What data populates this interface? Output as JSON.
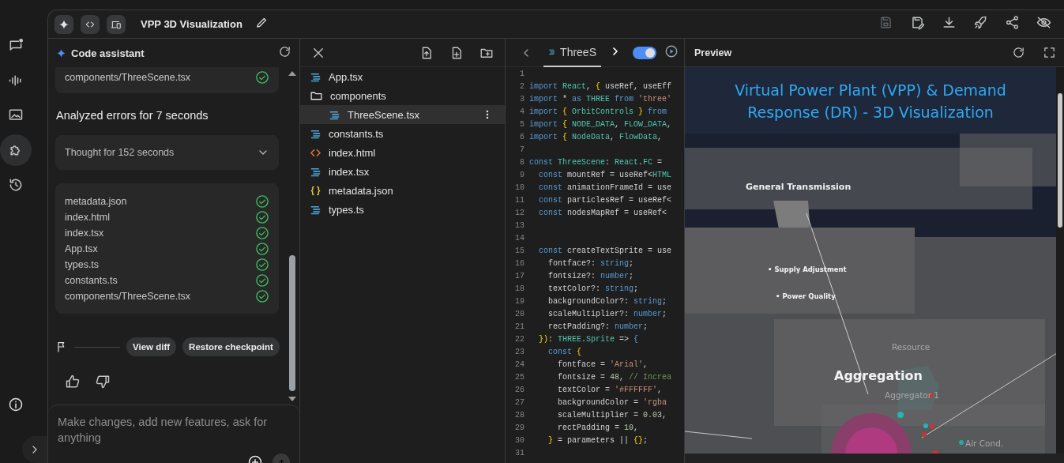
{
  "rail": {
    "items": [
      {
        "kind": "chat",
        "selected": false
      },
      {
        "kind": "audio",
        "selected": false
      },
      {
        "kind": "image",
        "selected": false
      },
      {
        "kind": "extension",
        "selected": true
      },
      {
        "kind": "history",
        "selected": false
      }
    ]
  },
  "toolbar": {
    "title": "VPP 3D Visualization",
    "actions": [
      {
        "kind": "save",
        "disabled": true
      },
      {
        "kind": "save-edit",
        "disabled": false
      },
      {
        "kind": "download",
        "disabled": false
      },
      {
        "kind": "rocket",
        "disabled": false
      },
      {
        "kind": "share",
        "disabled": false
      },
      {
        "kind": "eye-off",
        "disabled": false
      }
    ]
  },
  "assistant": {
    "title": "Code assistant",
    "earlier_files": [
      {
        "name": "components/ThreeScene.tsx",
        "done": true
      }
    ],
    "status": "Analyzed errors for 7 seconds",
    "thought": {
      "label": "Thought for 152 seconds",
      "expanded": false
    },
    "files": [
      {
        "name": "metadata.json",
        "done": true
      },
      {
        "name": "index.html",
        "done": true
      },
      {
        "name": "index.tsx",
        "done": true
      },
      {
        "name": "App.tsx",
        "done": true
      },
      {
        "name": "types.ts",
        "done": true
      },
      {
        "name": "constants.ts",
        "done": true
      },
      {
        "name": "components/ThreeScene.tsx",
        "done": true
      }
    ],
    "actions": [
      "View diff",
      "Restore checkpoint"
    ],
    "input": {
      "placeholder": "Make changes, add new features, ask for anything"
    }
  },
  "files": {
    "tree": [
      {
        "name": "App.tsx",
        "kind": "ts",
        "selected": false
      },
      {
        "name": "components",
        "kind": "folder",
        "selected": false,
        "children": [
          {
            "name": "ThreeScene.tsx",
            "kind": "ts",
            "selected": true
          }
        ]
      },
      {
        "name": "constants.ts",
        "kind": "ts",
        "selected": false
      },
      {
        "name": "index.html",
        "kind": "html",
        "selected": false
      },
      {
        "name": "index.tsx",
        "kind": "ts",
        "selected": false
      },
      {
        "name": "metadata.json",
        "kind": "json",
        "selected": false
      },
      {
        "name": "types.ts",
        "kind": "ts",
        "selected": false
      }
    ]
  },
  "editor": {
    "tab": "ThreeS",
    "toggle": {
      "on": true
    },
    "lines": [
      {
        "number": "1"
      },
      {
        "number": "2",
        "tokens": [
          {
            "text": "import",
            "kind": "kw"
          },
          {
            "text": " React",
            "kind": "ty"
          },
          {
            "text": ", ",
            "kind": "tx"
          },
          {
            "text": "{",
            "kind": "br"
          },
          {
            "text": " useRef, useEff",
            "kind": "tx"
          }
        ]
      },
      {
        "number": "3",
        "tokens": [
          {
            "text": "import",
            "kind": "kw"
          },
          {
            "text": " *",
            "kind": "tx"
          },
          {
            "text": " as",
            "kind": "kw"
          },
          {
            "text": " THREE",
            "kind": "ty"
          },
          {
            "text": " from",
            "kind": "kw"
          },
          {
            "text": " 'three'",
            "kind": "str"
          }
        ]
      },
      {
        "number": "4",
        "tokens": [
          {
            "text": "import",
            "kind": "kw"
          },
          {
            "text": " {",
            "kind": "br"
          },
          {
            "text": " OrbitControls",
            "kind": "ty"
          },
          {
            "text": " }",
            "kind": "br"
          },
          {
            "text": " from",
            "kind": "kw"
          }
        ]
      },
      {
        "number": "5",
        "tokens": [
          {
            "text": "import",
            "kind": "kw"
          },
          {
            "text": " {",
            "kind": "br"
          },
          {
            "text": " NODE_DATA",
            "kind": "ty"
          },
          {
            "text": ", ",
            "kind": "tx"
          },
          {
            "text": "FLOW_DATA",
            "kind": "ty"
          },
          {
            "text": ",",
            "kind": "tx"
          }
        ]
      },
      {
        "number": "6",
        "tokens": [
          {
            "text": "import",
            "kind": "kw"
          },
          {
            "text": " {",
            "kind": "br"
          },
          {
            "text": " NodeData",
            "kind": "ty"
          },
          {
            "text": ", ",
            "kind": "tx"
          },
          {
            "text": "FlowData",
            "kind": "ty"
          },
          {
            "text": ",",
            "kind": "tx"
          }
        ]
      },
      {
        "number": "7"
      },
      {
        "number": "8",
        "tokens": [
          {
            "text": "const",
            "kind": "kw"
          },
          {
            "text": " ThreeScene",
            "kind": "ty"
          },
          {
            "text": ": ",
            "kind": "tx"
          },
          {
            "text": "React",
            "kind": "ty"
          },
          {
            "text": ".",
            "kind": "tx"
          },
          {
            "text": "FC",
            "kind": "ty"
          },
          {
            "text": " =",
            "kind": "tx"
          }
        ]
      },
      {
        "number": "9",
        "tokens": [
          {
            "text": "  const",
            "kind": "kw"
          },
          {
            "text": " mountRef = useRef<",
            "kind": "tx"
          },
          {
            "text": "HTML",
            "kind": "ty"
          }
        ]
      },
      {
        "number": "10",
        "tokens": [
          {
            "text": "  const",
            "kind": "kw"
          },
          {
            "text": " animationFrameId = use",
            "kind": "tx"
          }
        ]
      },
      {
        "number": "11",
        "tokens": [
          {
            "text": "  const",
            "kind": "kw"
          },
          {
            "text": " particlesRef = useRef<",
            "kind": "tx"
          }
        ]
      },
      {
        "number": "12",
        "tokens": [
          {
            "text": "  const",
            "kind": "kw"
          },
          {
            "text": " nodesMapRef = useRef<",
            "kind": "tx"
          }
        ]
      },
      {
        "number": "13"
      },
      {
        "number": "14"
      },
      {
        "number": "15",
        "tokens": [
          {
            "text": "  const",
            "kind": "kw"
          },
          {
            "text": " createTextSprite = use",
            "kind": "tx"
          }
        ]
      },
      {
        "number": "16",
        "tokens": [
          {
            "text": "    fontface?: ",
            "kind": "tx"
          },
          {
            "text": "string",
            "kind": "kw"
          },
          {
            "text": ";",
            "kind": "tx"
          }
        ]
      },
      {
        "number": "17",
        "tokens": [
          {
            "text": "    fontsize?: ",
            "kind": "tx"
          },
          {
            "text": "number",
            "kind": "kw"
          },
          {
            "text": ";",
            "kind": "tx"
          }
        ]
      },
      {
        "number": "18",
        "tokens": [
          {
            "text": "    textColor?: ",
            "kind": "tx"
          },
          {
            "text": "string",
            "kind": "kw"
          },
          {
            "text": ";",
            "kind": "tx"
          }
        ]
      },
      {
        "number": "19",
        "tokens": [
          {
            "text": "    backgroundColor?: ",
            "kind": "tx"
          },
          {
            "text": "string",
            "kind": "kw"
          },
          {
            "text": ";",
            "kind": "tx"
          }
        ]
      },
      {
        "number": "20",
        "tokens": [
          {
            "text": "    scaleMultiplier?: ",
            "kind": "tx"
          },
          {
            "text": "number",
            "kind": "kw"
          },
          {
            "text": ";",
            "kind": "tx"
          }
        ]
      },
      {
        "number": "21",
        "tokens": [
          {
            "text": "    rectPadding?: ",
            "kind": "tx"
          },
          {
            "text": "number",
            "kind": "kw"
          },
          {
            "text": ";",
            "kind": "tx"
          }
        ]
      },
      {
        "number": "22",
        "tokens": [
          {
            "text": "  })",
            "kind": "br"
          },
          {
            "text": ": ",
            "kind": "tx"
          },
          {
            "text": "THREE",
            "kind": "ty"
          },
          {
            "text": ".",
            "kind": "tx"
          },
          {
            "text": "Sprite",
            "kind": "ty"
          },
          {
            "text": " =>",
            "kind": "tx"
          },
          {
            "text": " {",
            "kind": "kw"
          }
        ]
      },
      {
        "number": "23",
        "tokens": [
          {
            "text": "    const",
            "kind": "kw"
          },
          {
            "text": " {",
            "kind": "br"
          }
        ]
      },
      {
        "number": "24",
        "tokens": [
          {
            "text": "      fontface = ",
            "kind": "tx"
          },
          {
            "text": "'Arial'",
            "kind": "str"
          },
          {
            "text": ",",
            "kind": "tx"
          }
        ]
      },
      {
        "number": "25",
        "tokens": [
          {
            "text": "      fontsize = ",
            "kind": "tx"
          },
          {
            "text": "48",
            "kind": "num"
          },
          {
            "text": ", ",
            "kind": "tx"
          },
          {
            "text": "// Increa",
            "kind": "cm"
          }
        ]
      },
      {
        "number": "26",
        "tokens": [
          {
            "text": "      textColor = ",
            "kind": "tx"
          },
          {
            "text": "'#FFFFFF'",
            "kind": "str"
          },
          {
            "text": ",",
            "kind": "tx"
          }
        ]
      },
      {
        "number": "27",
        "tokens": [
          {
            "text": "      backgroundColor = ",
            "kind": "tx"
          },
          {
            "text": "'rgba",
            "kind": "str"
          }
        ]
      },
      {
        "number": "28",
        "tokens": [
          {
            "text": "      scaleMultiplier = ",
            "kind": "tx"
          },
          {
            "text": "0.03",
            "kind": "num"
          },
          {
            "text": ",",
            "kind": "tx"
          }
        ]
      },
      {
        "number": "29",
        "tokens": [
          {
            "text": "      rectPadding = ",
            "kind": "tx"
          },
          {
            "text": "10",
            "kind": "num"
          },
          {
            "text": ",",
            "kind": "tx"
          }
        ]
      },
      {
        "number": "30",
        "tokens": [
          {
            "text": "    }",
            "kind": "br"
          },
          {
            "text": " = parameters || ",
            "kind": "tx"
          },
          {
            "text": "{}",
            "kind": "br"
          },
          {
            "text": ";",
            "kind": "tx"
          }
        ]
      },
      {
        "number": "31"
      }
    ]
  },
  "preview": {
    "title": "Preview",
    "banner": "Virtual Power Plant (VPP) & Demand Response (DR) - 3D Visualization",
    "labels": [
      {
        "text": "General Transmission",
        "kind": "node"
      },
      {
        "text": "• Supply Adjustment",
        "kind": "bullet"
      },
      {
        "text": "• Power Quality",
        "kind": "bullet"
      },
      {
        "text": "Resource",
        "kind": "faint"
      },
      {
        "text": "Aggregation",
        "kind": "heading"
      },
      {
        "text": "Aggregator 1",
        "kind": "faint"
      },
      {
        "text": "Air Cond.",
        "kind": "faint"
      }
    ]
  }
}
